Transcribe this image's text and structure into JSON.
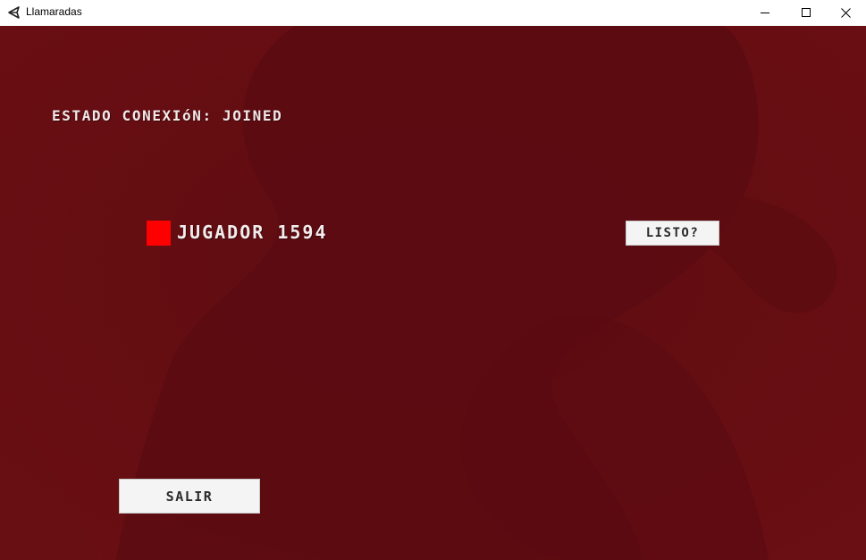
{
  "window": {
    "title": "Llamaradas",
    "icon": "unity-logo-icon"
  },
  "lobby": {
    "connection_status": "ESTADO CONEXIóN: JOINED",
    "player": {
      "name": "JUGADOR 1594",
      "color": "#ff0000"
    },
    "ready_button_label": "LISTO?",
    "exit_button_label": "SALIR"
  },
  "theme": {
    "background": "#650d12",
    "button_background": "#f4f4f4"
  }
}
